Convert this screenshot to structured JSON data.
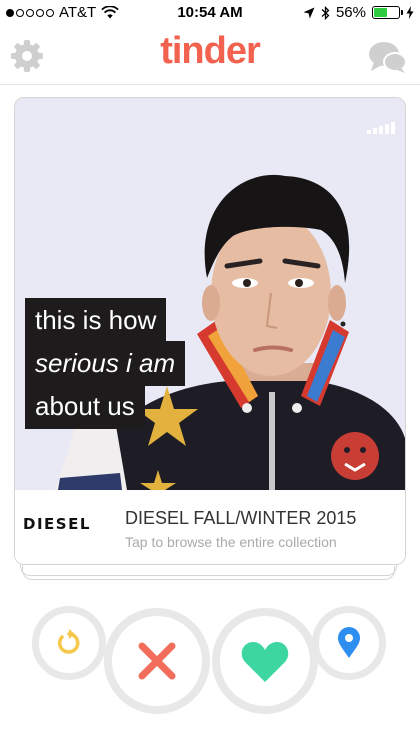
{
  "status_bar": {
    "carrier": "AT&T",
    "time": "10:54 AM",
    "battery": "56%",
    "battery_level": 0.56,
    "signal_bars": 1,
    "icons": [
      "wifi-icon",
      "location-arrow-icon",
      "bluetooth-icon",
      "charging-bolt-icon"
    ]
  },
  "header": {
    "logo": "tinder",
    "left_icon": "gear-icon",
    "right_icon": "chat-bubbles-icon"
  },
  "card": {
    "caption_lines": [
      "this is how",
      "serious i am",
      "about us"
    ],
    "brand": "DIESEL",
    "title": "DIESEL FALL/WINTER 2015",
    "subtitle": "Tap to browse the entire collection"
  },
  "actions": [
    {
      "name": "rewind",
      "icon": "rewind-icon",
      "color": "#f5c74a"
    },
    {
      "name": "dislike",
      "icon": "x-icon",
      "color": "#f26d5b"
    },
    {
      "name": "like",
      "icon": "heart-icon",
      "color": "#3dd6a0"
    },
    {
      "name": "location",
      "icon": "map-pin-icon",
      "color": "#2d8ef0"
    }
  ],
  "colors": {
    "brand": "#f2624e",
    "photo_background": "#e9e8f5",
    "caption_background": "#1d1b1b"
  }
}
